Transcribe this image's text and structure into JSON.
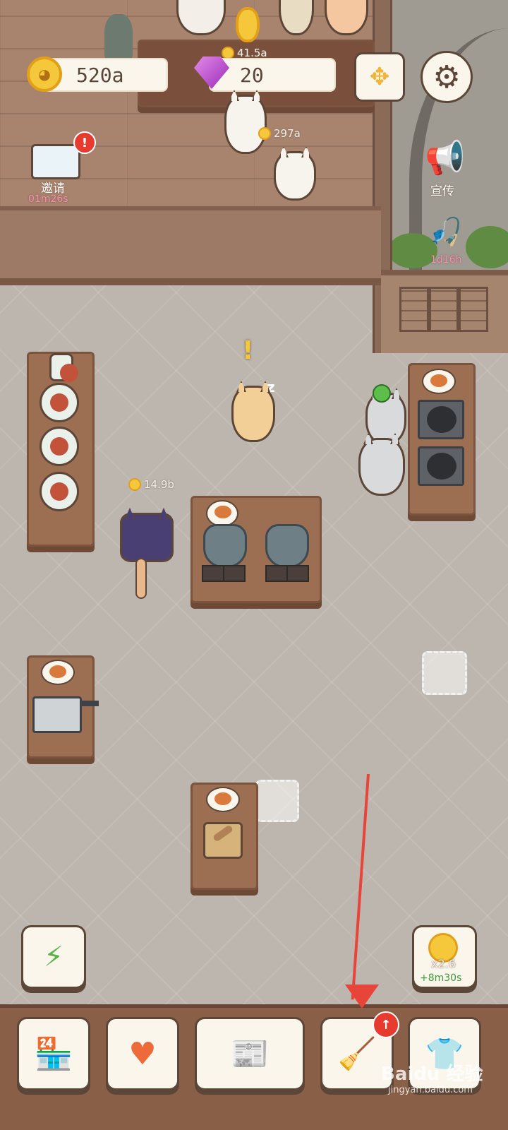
{
  "hud": {
    "coins": "520a",
    "gems": "20",
    "coin_icon": "cat-coin-icon",
    "gem_icon": "purple-gem-icon"
  },
  "side_actions": {
    "invite_label": "邀请",
    "invite_timer": "01m26s",
    "invite_badge": "!",
    "promote_label": "宣传",
    "fishing_timer": "1d16h"
  },
  "floating_earnings": {
    "top_counter": "41.5a",
    "waiter": "297a",
    "customer": "14.9b"
  },
  "speech": {
    "alert_mark": "!",
    "sleep_mark": "z"
  },
  "boost": {
    "multiplier": "x2.6",
    "ad_bonus": "+8m30s"
  },
  "bottom_nav": {
    "upgrade_badge": "↑",
    "items": [
      "shop",
      "cats",
      "recipes",
      "decorate",
      "outfits"
    ]
  },
  "watermark": {
    "brand": "Baidu 经验",
    "url": "jingyan.baidu.com"
  },
  "colors": {
    "annotation_arrow": "#e8453a",
    "coin": "#f5c73b",
    "badge": "#e63b2e"
  }
}
